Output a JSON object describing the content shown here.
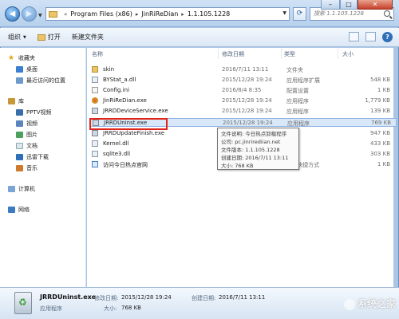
{
  "address": {
    "segments": [
      "Program Files (x86)",
      "JinRiReDian",
      "1.1.105.1228"
    ],
    "prefix": "«"
  },
  "search": {
    "placeholder": "搜索 1.1.105.1228"
  },
  "toolbar": {
    "organize": "组织",
    "open": "打开",
    "new_folder": "新建文件夹"
  },
  "sidebar": {
    "favorites": "收藏夹",
    "desktop": "桌面",
    "recent": "最近访问的位置",
    "libraries": "库",
    "pptv": "PPTV视频",
    "videos": "视频",
    "pictures": "图片",
    "documents": "文档",
    "downloads": "迅雷下载",
    "music": "音乐",
    "computer": "计算机",
    "network": "网络"
  },
  "columns": {
    "name": "名称",
    "date": "修改日期",
    "type": "类型",
    "size": "大小"
  },
  "files": [
    {
      "name": "skin",
      "date": "2016/7/11 13:11",
      "type": "文件夹",
      "size": "",
      "icon": "folder-icon"
    },
    {
      "name": "BYStat_a.dll",
      "date": "2015/12/28 19:24",
      "type": "应用程序扩展",
      "size": "548 KB",
      "icon": "dll-icon"
    },
    {
      "name": "Config.ini",
      "date": "2016/8/4 8:35",
      "type": "配置设置",
      "size": "1 KB",
      "icon": "ini-icon"
    },
    {
      "name": "JinRiReDian.exe",
      "date": "2015/12/28 19:24",
      "type": "应用程序",
      "size": "1,779 KB",
      "icon": "app-icon"
    },
    {
      "name": "JRRDDeviceService.exe",
      "date": "2015/12/28 19:24",
      "type": "应用程序",
      "size": "139 KB",
      "icon": "exe-icon"
    },
    {
      "name": "JRRDUninst.exe",
      "date": "2015/12/28 19:24",
      "type": "应用程序",
      "size": "769 KB",
      "icon": "uninstall-icon"
    },
    {
      "name": "JRRDUpdateFinish.exe",
      "date": "",
      "type": "",
      "size": "947 KB",
      "icon": "exe-icon"
    },
    {
      "name": "Kernel.dll",
      "date": "",
      "type": "",
      "size": "433 KB",
      "icon": "dll-icon"
    },
    {
      "name": "sqlite3.dll",
      "date": "",
      "type": "",
      "size": "303 KB",
      "icon": "dll-icon"
    },
    {
      "name": "访问今日热点官网",
      "date": "",
      "type": "et 快捷方式",
      "size": "1 KB",
      "icon": "url-icon"
    }
  ],
  "tooltip": {
    "line1": "文件说明: 今日热点卸载程序",
    "line2": "公司: pc.jinrirediian.net",
    "line3": "文件版本: 1.1.105.1228",
    "line4": "创建日期: 2016/7/11 13:11",
    "line5": "大小: 768 KB"
  },
  "details": {
    "name": "JRRDUninst.exe",
    "modified_label": "修改日期:",
    "modified": "2015/12/28 19:24",
    "created_label": "创建日期:",
    "created": "2016/7/11 13:11",
    "type": "应用程序",
    "size_label": "大小:",
    "size": "768 KB"
  },
  "watermark": "系统之家"
}
